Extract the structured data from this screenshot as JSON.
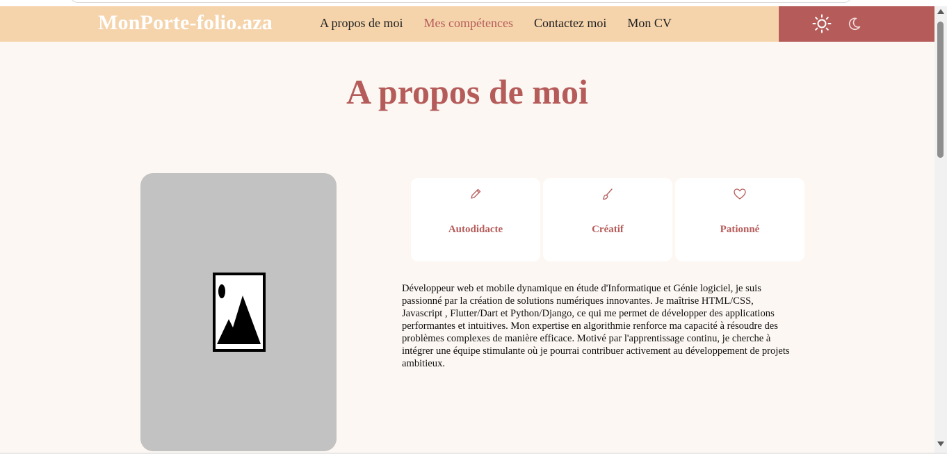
{
  "header": {
    "brand": "MonPorte-folio.aza",
    "nav": [
      {
        "label": "A propos de moi",
        "active": false
      },
      {
        "label": "Mes compétences",
        "active": true
      },
      {
        "label": "Contactez moi",
        "active": false
      },
      {
        "label": "Mon CV",
        "active": false
      }
    ],
    "theme_icons": [
      "sun-icon",
      "moon-icon"
    ]
  },
  "about": {
    "title": "A propos de moi",
    "photo_icon": "image-placeholder-icon",
    "cards": [
      {
        "icon": "pencil-icon",
        "label": "Autodidacte"
      },
      {
        "icon": "brush-icon",
        "label": "Créatif"
      },
      {
        "icon": "heart-icon",
        "label": "Pationné"
      }
    ],
    "description": "Développeur web et mobile dynamique en étude d'Informatique et Génie logiciel, je suis passionné par la création de solutions numériques innovantes. Je maîtrise HTML/CSS, Javascript , Flutter/Dart et Python/Django, ce qui me permet de développer des applications performantes et intuitives. Mon expertise en algorithmie renforce ma capacité à résoudre des problèmes complexes de manière efficace. Motivé par l'apprentissage continu, je cherche à intégrer une équipe stimulante où je pourrai contribuer activement au développement de projets ambitieux."
  },
  "colors": {
    "navbar": "#f5d4ac",
    "accent": "#b55c5a",
    "page_bg": "#fcf7f2",
    "photo_placeholder": "#c2c2c2"
  }
}
